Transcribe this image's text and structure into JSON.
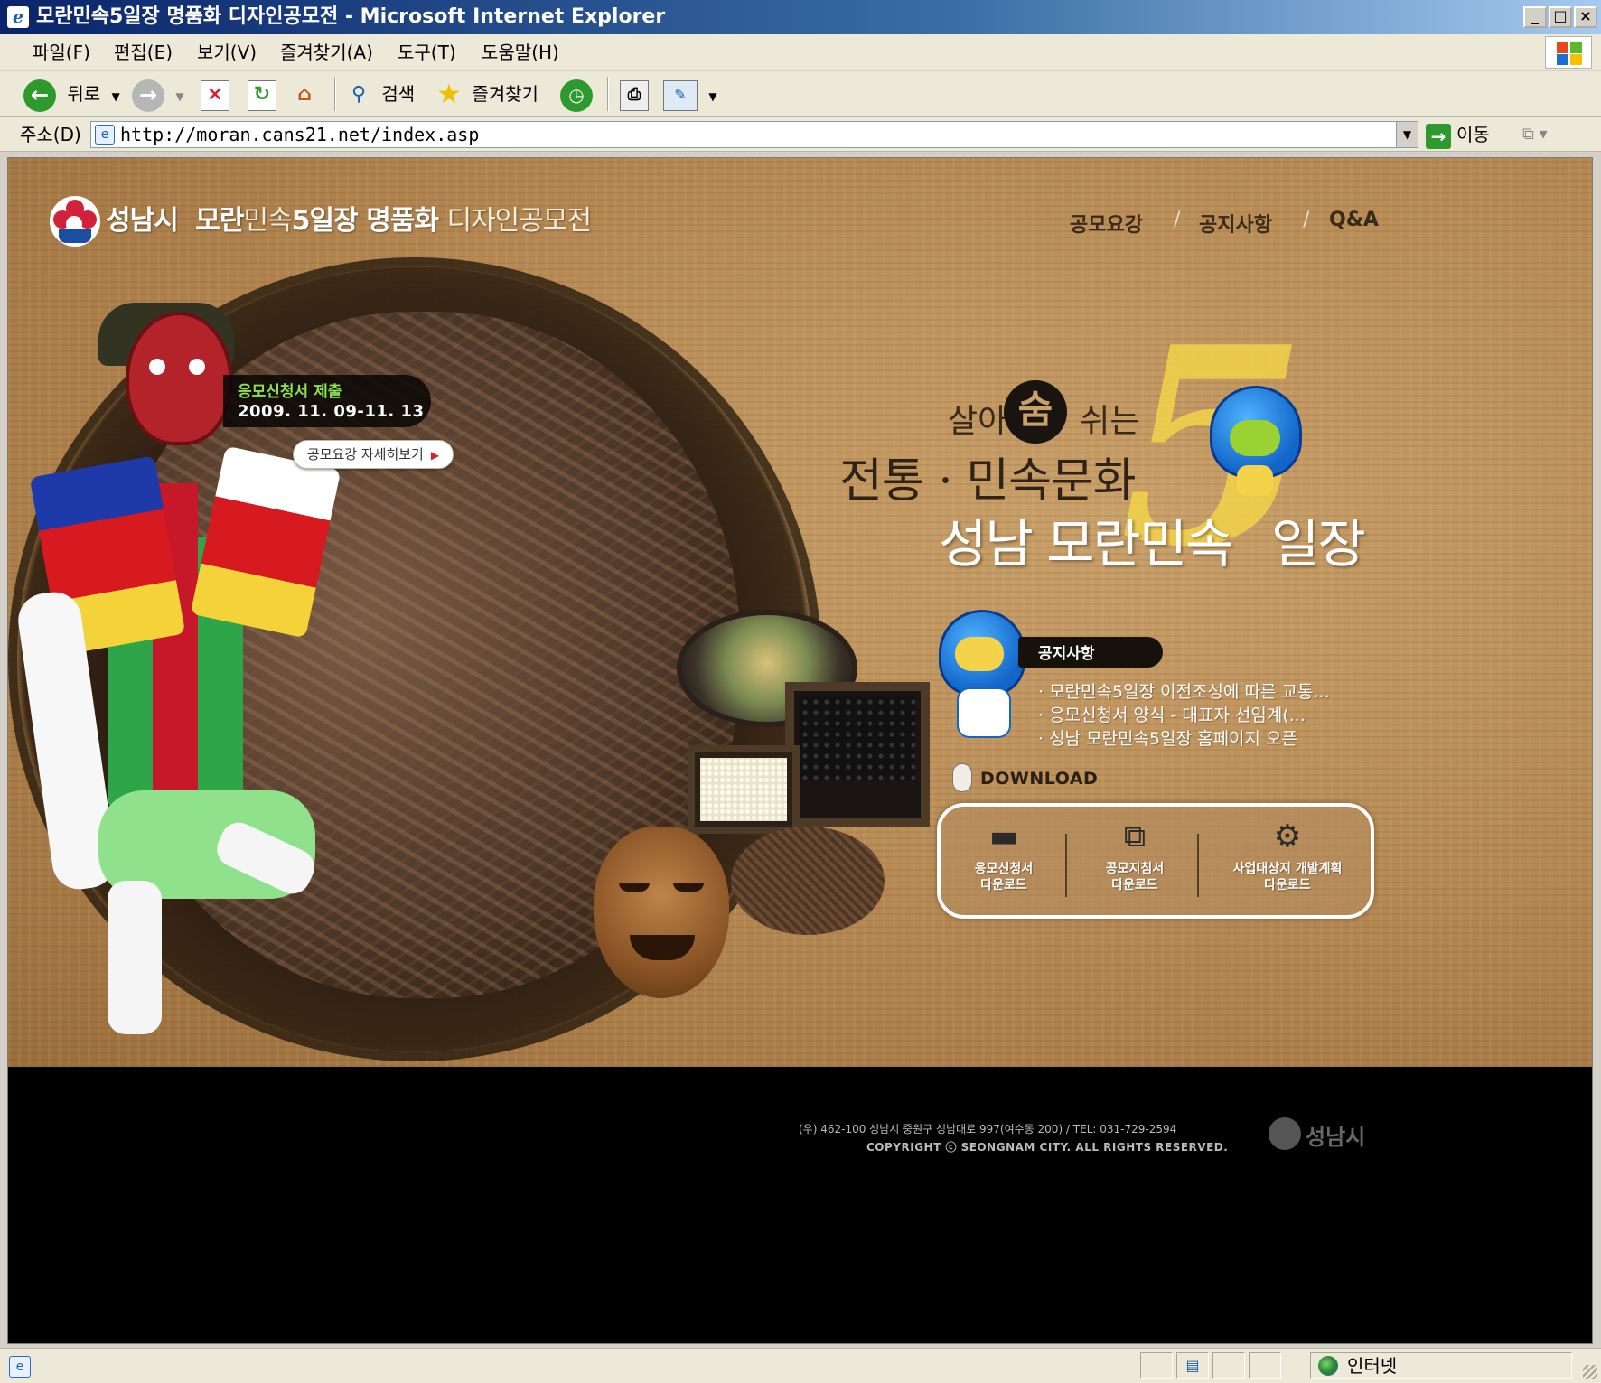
{
  "window": {
    "title": "모란민속5일장 명품화 디자인공모전 - Microsoft Internet Explorer",
    "min_label": "_",
    "max_label": "□",
    "close_label": "×"
  },
  "menu": {
    "items": [
      "파일(F)",
      "편집(E)",
      "보기(V)",
      "즐겨찾기(A)",
      "도구(T)",
      "도움말(H)"
    ]
  },
  "toolbar": {
    "back_label": "뒤로",
    "search_label": "검색",
    "favorites_label": "즐겨찾기"
  },
  "address": {
    "label": "주소(D)",
    "url": "http://moran.cans21.net/index.asp",
    "go_label": "이동"
  },
  "site": {
    "logo_city": "성남시",
    "logo_bold1": "모란",
    "logo_thin1": "민속",
    "logo_bold2": "5일장",
    "logo_bold3": "명품화",
    "logo_thin2": "디자인공모전",
    "nav": [
      "공모요강",
      "공지사항",
      "Q&A"
    ],
    "nav_separator": "/",
    "apply": {
      "label": "응모신청서 제출",
      "dates": "2009. 11. 09-11. 13",
      "button": "공모요강 자세히보기"
    },
    "slogan": {
      "line1_a": "살아",
      "line1_soom": "숨",
      "line1_b": "쉬는",
      "line2": "전통 · 민속문화",
      "line3_a": "성남 모란민속",
      "line3_b": "일장",
      "big_number": "5"
    },
    "notice": {
      "title": "공지사항",
      "items": [
        "· 모란민속5일장 이전조성에 따른 교통...",
        "· 응모신청서 양식 - 대표자 선임계(...",
        "· 성남 모란민속5일장 홈페이지 오픈"
      ]
    },
    "download": {
      "label": "DOWNLOAD",
      "items": [
        {
          "line1": "응모신청서",
          "line2": "다운로드",
          "icon": "folder-icon"
        },
        {
          "line1": "공모지침서",
          "line2": "다운로드",
          "icon": "tv-icon"
        },
        {
          "line1": "사업대상지 개발계획",
          "line2": "다운로드",
          "icon": "gear-icon"
        }
      ]
    },
    "footer": {
      "address": "(우) 462-100 성남시 중원구 성남대로 997(여수동 200)  /  TEL: 031-729-2594",
      "copyright": "COPYRIGHT ⓒ SEONGNAM CITY. ALL RIGHTS RESERVED.",
      "logo_text": "성남시"
    }
  },
  "status": {
    "zone": "인터넷"
  }
}
